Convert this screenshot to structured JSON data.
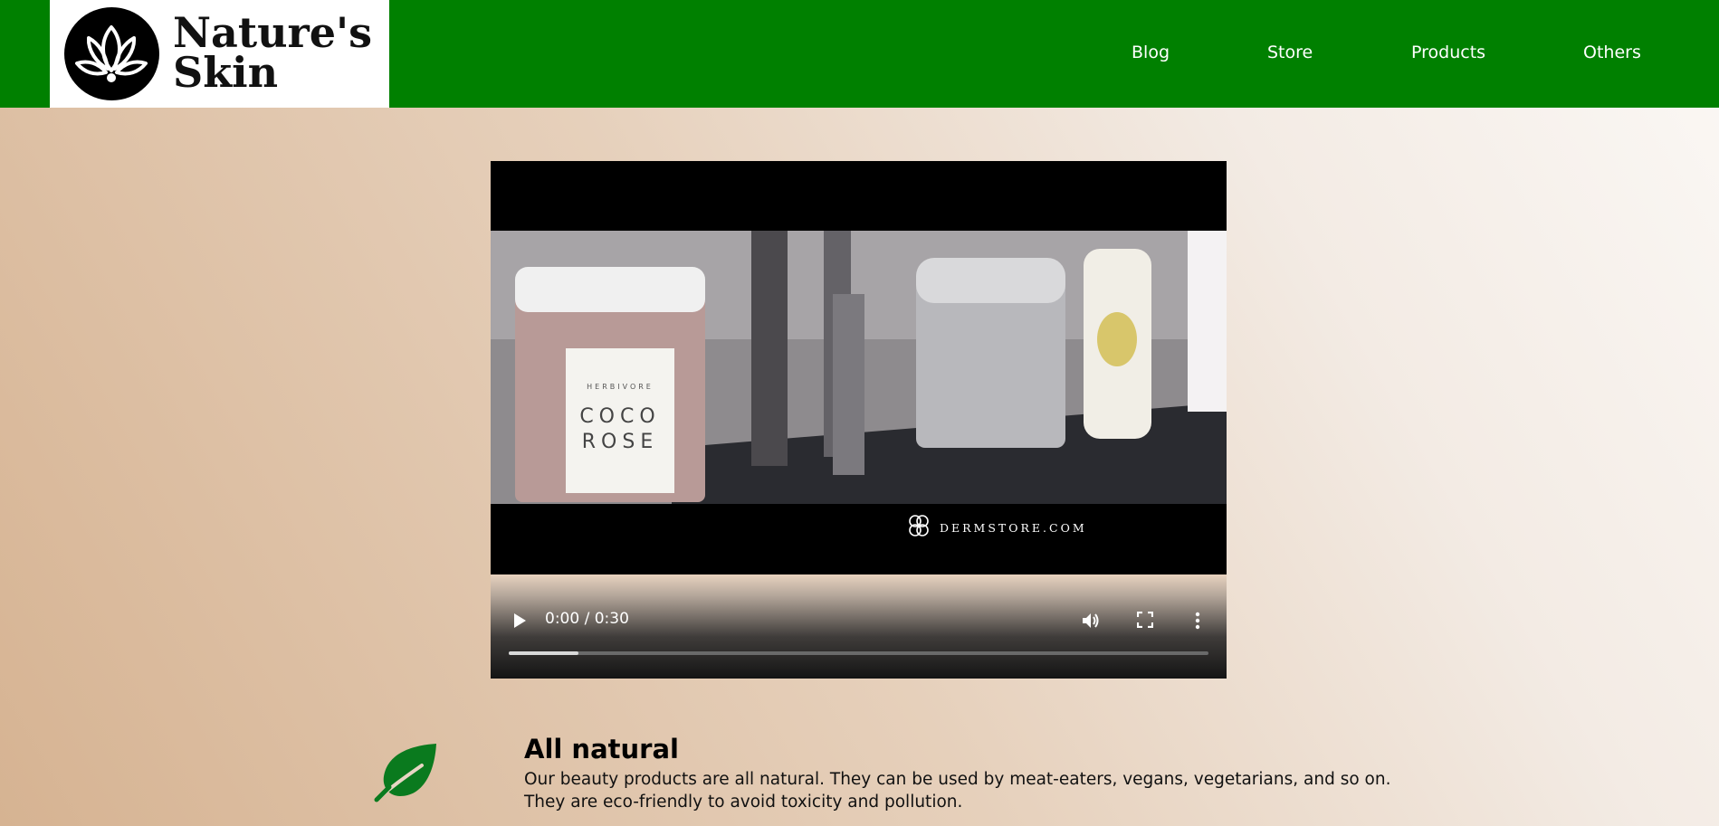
{
  "header": {
    "logo": {
      "line1": "Nature's",
      "line2": "Skin",
      "icon": "lotus-icon"
    },
    "nav": [
      {
        "label": "Blog"
      },
      {
        "label": "Store"
      },
      {
        "label": "Products"
      },
      {
        "label": "Others"
      }
    ]
  },
  "video": {
    "watermark": "DERMSTORE.COM",
    "product_labels": [
      "HERBIVORE",
      "COCO",
      "ROSE"
    ],
    "time_display": "0:00 / 0:30",
    "progress": 0.1,
    "controls": [
      "play-icon",
      "volume-icon",
      "fullscreen-icon",
      "more-options-icon"
    ]
  },
  "feature": {
    "icon": "leaf-icon",
    "title": "All natural",
    "text": "Our beauty products are all natural. They can be used by meat-eaters, vegans, vegetarians, and so on. They are eco-friendly to avoid toxicity and pollution."
  },
  "colors": {
    "header_bg": "#008000",
    "leaf_icon": "#0a7a1e",
    "video_bg": "#000000"
  }
}
